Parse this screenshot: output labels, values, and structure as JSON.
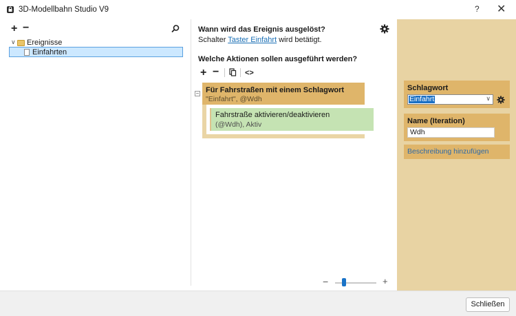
{
  "window": {
    "title": "3D-Modellbahn Studio V9",
    "help": "?",
    "close": "✕"
  },
  "left": {
    "add": "+",
    "remove": "−",
    "tree": {
      "root": "Ereignisse",
      "child": "Einfahrten"
    }
  },
  "middle": {
    "heading_when": "Wann wird das Ereignis ausgelöst?",
    "trigger_prefix": "Schalter ",
    "trigger_link": "Taster Einfahrt",
    "trigger_suffix": " wird betätigt.",
    "heading_actions": "Welche Aktionen sollen ausgeführt werden?",
    "tools": {
      "add": "+",
      "remove": "−",
      "code": "<>"
    },
    "loop": {
      "title": "Für Fahrstraßen mit einem Schlagwort",
      "sub": "\"Einfahrt\", @Wdh"
    },
    "action": {
      "title": "Fahrstraße aktivieren/deaktivieren",
      "sub": "(@Wdh), Aktiv"
    },
    "zoom": {
      "minus": "−",
      "plus": "+",
      "level": 0.2
    }
  },
  "right": {
    "tag_label": "Schlagwort",
    "tag_value": "Einfahrt",
    "name_label": "Name (Iteration)",
    "name_value": "Wdh",
    "add_description": "Beschreibung hinzufügen"
  },
  "footer": {
    "close_label": "Schließen"
  },
  "colors": {
    "loop_block": "#dfb56a",
    "action_block": "#c5e3b3",
    "right_pane": "#e8d3a3",
    "link": "#1a6fb5",
    "selection": "#cce8ff"
  }
}
